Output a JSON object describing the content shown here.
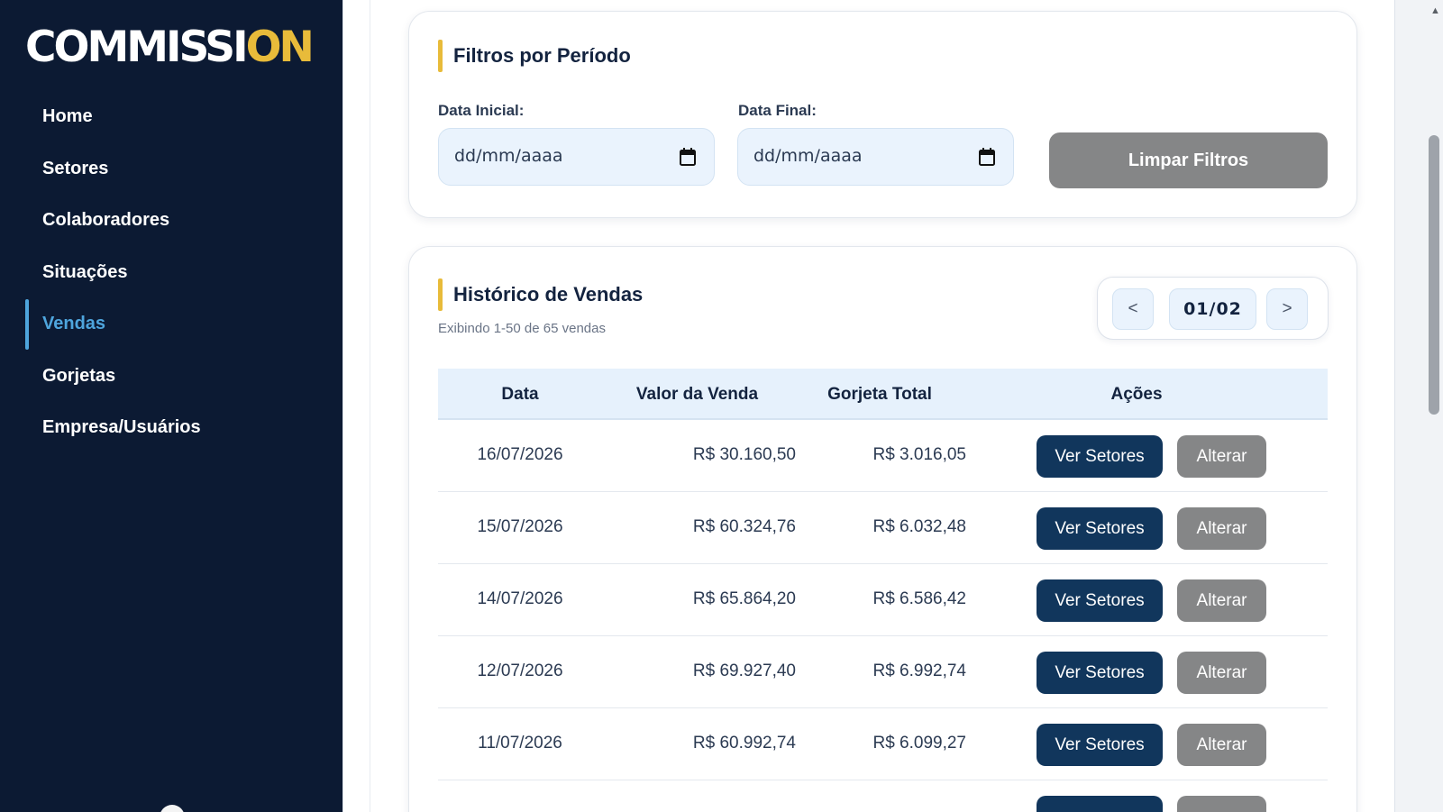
{
  "app": {
    "logo_main": "COMMISSI",
    "logo_accent": "ON"
  },
  "colors": {
    "sidebar_bg": "#0c1a33",
    "accent_gold": "#e8bb3a",
    "active_blue": "#4ea5dd",
    "primary_button": "#11365c",
    "secondary_button": "#858687"
  },
  "sidebar": {
    "items": [
      {
        "label": "Home",
        "active": false
      },
      {
        "label": "Setores",
        "active": false
      },
      {
        "label": "Colaboradores",
        "active": false
      },
      {
        "label": "Situações",
        "active": false
      },
      {
        "label": "Vendas",
        "active": true
      },
      {
        "label": "Gorjetas",
        "active": false
      },
      {
        "label": "Empresa/Usuários",
        "active": false
      }
    ]
  },
  "filters": {
    "title": "Filtros por Período",
    "start_label": "Data Inicial:",
    "start_value": "dd/mm/aaaa",
    "end_label": "Data Final:",
    "end_value": "dd/mm/aaaa",
    "clear_button": "Limpar Filtros",
    "calendar_icon": "calendar-icon"
  },
  "history": {
    "title": "Histórico de Vendas",
    "subtitle": "Exibindo 1-50 de 65 vendas",
    "pager": {
      "prev": "<",
      "page": "01/02",
      "next": ">"
    },
    "columns": [
      "Data",
      "Valor da Venda",
      "Gorjeta Total",
      "Ações"
    ],
    "rows": [
      {
        "date": "16/07/2026",
        "value": "R$ 30.160,50",
        "tip": "R$ 3.016,05",
        "view_label": "Ver Setores",
        "edit_label": "Alterar"
      },
      {
        "date": "15/07/2026",
        "value": "R$ 60.324,76",
        "tip": "R$ 6.032,48",
        "view_label": "Ver Setores",
        "edit_label": "Alterar"
      },
      {
        "date": "14/07/2026",
        "value": "R$ 65.864,20",
        "tip": "R$ 6.586,42",
        "view_label": "Ver Setores",
        "edit_label": "Alterar"
      },
      {
        "date": "12/07/2026",
        "value": "R$ 69.927,40",
        "tip": "R$ 6.992,74",
        "view_label": "Ver Setores",
        "edit_label": "Alterar"
      },
      {
        "date": "11/07/2026",
        "value": "R$ 60.992,74",
        "tip": "R$ 6.099,27",
        "view_label": "Ver Setores",
        "edit_label": "Alterar"
      }
    ]
  }
}
